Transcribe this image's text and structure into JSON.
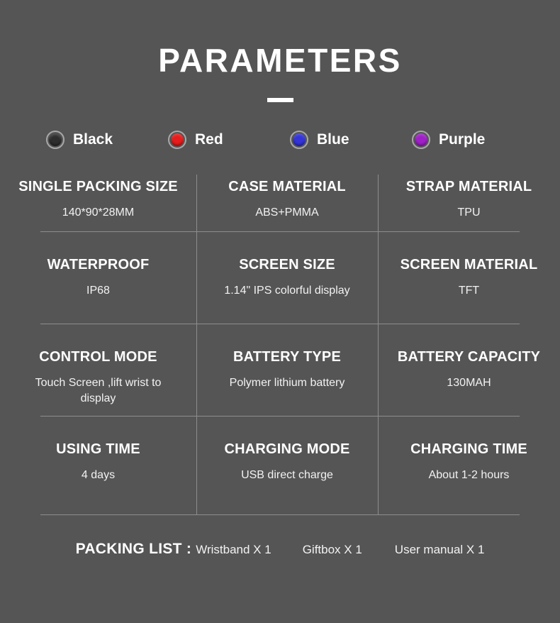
{
  "header": {
    "title": "PARAMETERS"
  },
  "colors": [
    {
      "label": "Black",
      "swatch": "black-swatch",
      "hex": "#2e2e2e"
    },
    {
      "label": "Red",
      "swatch": "red-swatch",
      "hex": "#e81c1c"
    },
    {
      "label": "Blue",
      "swatch": "blue-swatch",
      "hex": "#3434d8"
    },
    {
      "label": "Purple",
      "swatch": "purple-swatch",
      "hex": "#a020c8"
    }
  ],
  "specs": {
    "rows": [
      {
        "cells": [
          {
            "title": "SINGLE PACKING SIZE",
            "value": "140*90*28MM"
          },
          {
            "title": "CASE MATERIAL",
            "value": "ABS+PMMA"
          },
          {
            "title": "STRAP MATERIAL",
            "value": "TPU"
          }
        ]
      },
      {
        "cells": [
          {
            "title": "WATERPROOF",
            "value": "IP68"
          },
          {
            "title": "SCREEN SIZE",
            "value": "1.14\" IPS colorful display"
          },
          {
            "title": "SCREEN MATERIAL",
            "value": "TFT"
          }
        ]
      },
      {
        "cells": [
          {
            "title": "CONTROL MODE",
            "value": "Touch Screen ,lift wrist to display"
          },
          {
            "title": "BATTERY TYPE",
            "value": "Polymer lithium battery"
          },
          {
            "title": "BATTERY CAPACITY",
            "value": "130MAH"
          }
        ]
      },
      {
        "cells": [
          {
            "title": "USING TIME",
            "value": "4 days"
          },
          {
            "title": "CHARGING MODE",
            "value": "USB direct charge"
          },
          {
            "title": "CHARGING TIME",
            "value": "About 1-2 hours"
          }
        ]
      }
    ]
  },
  "packing_list": {
    "label": "PACKING LIST :",
    "items": [
      "Wristband X 1",
      "Giftbox X 1",
      "User manual X 1"
    ]
  },
  "theme": {
    "background": "#555555",
    "text": "#ffffff",
    "divider": "#8d8d8d",
    "swatch_ring": "#a8a8a8"
  }
}
